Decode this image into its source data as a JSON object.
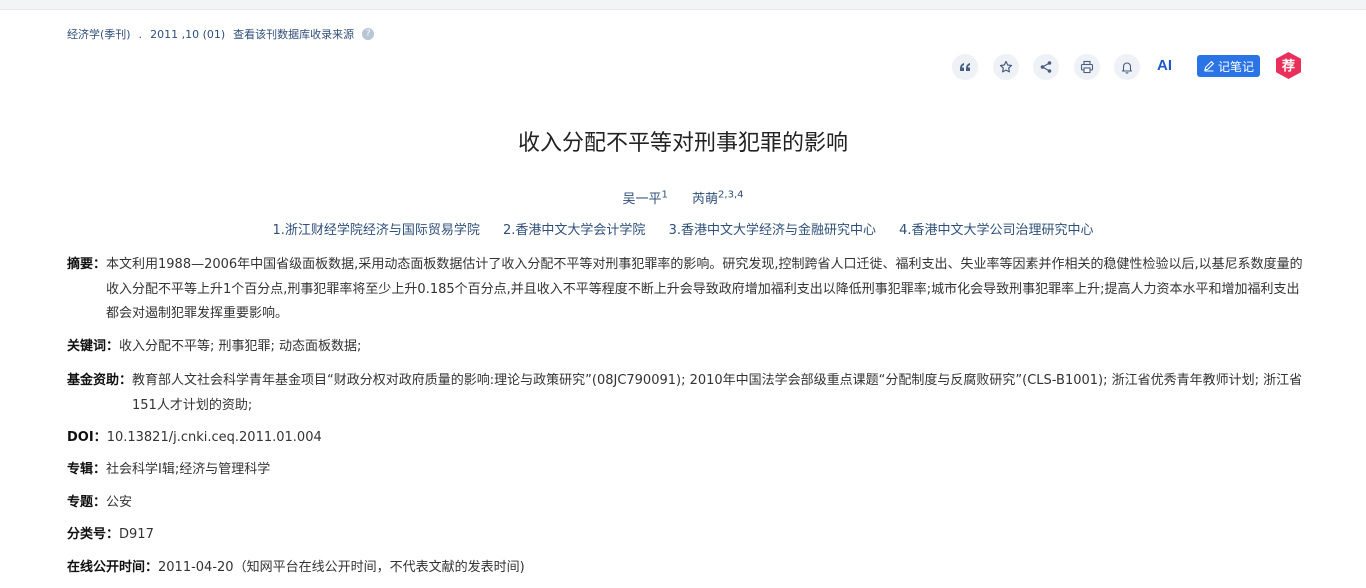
{
  "source": {
    "journal": "经济学(季刊)",
    "sep": ".",
    "issue": "2011 ,10 (01)",
    "link": "查看该刊数据库收录来源",
    "help": "?"
  },
  "toolbar": {
    "ai_label": "AI",
    "note_label": "记笔记",
    "rec_label": "荐"
  },
  "article": {
    "title": "收入分配不平等对刑事犯罪的影响",
    "authors": [
      {
        "name": "吴一平",
        "sup": "1"
      },
      {
        "name": "芮萌",
        "sup": "2,3,4"
      }
    ],
    "affiliations": [
      "1.浙江财经学院经济与国际贸易学院",
      "2.香港中文大学会计学院",
      "3.香港中文大学经济与金融研究中心",
      "4.香港中文大学公司治理研究中心"
    ]
  },
  "fields": {
    "abstract_label": "摘要：",
    "abstract": "本文利用1988—2006年中国省级面板数据,采用动态面板数据估计了收入分配不平等对刑事犯罪率的影响。研究发现,控制跨省人口迁徙、福利支出、失业率等因素并作相关的稳健性检验以后,以基尼系数度量的收入分配不平等上升1个百分点,刑事犯罪率将至少上升0.185个百分点,并且收入不平等程度不断上升会导致政府增加福利支出以降低刑事犯罪率;城市化会导致刑事犯罪率上升;提高人力资本水平和增加福利支出都会对遏制犯罪发挥重要影响。",
    "keywords_label": "关键词：",
    "keywords": "收入分配不平等;  刑事犯罪;  动态面板数据;",
    "fund_label": "基金资助：",
    "fund": "教育部人文社会科学青年基金项目“财政分权对政府质量的影响:理论与政策研究”(08JC790091);  2010年中国法学会部级重点课题“分配制度与反腐败研究”(CLS-B1001);  浙江省优秀青年教师计划;  浙江省151人才计划的资助;",
    "doi_label": "DOI：",
    "doi": "10.13821/j.cnki.ceq.2011.01.004",
    "series_label": "专辑：",
    "series": "社会科学Ⅰ辑;经济与管理科学",
    "topic_label": "专题：",
    "topic": "公安",
    "class_label": "分类号：",
    "class_no": "D917",
    "online_label": "在线公开时间：",
    "online": "2011-04-20（知网平台在线公开时间，不代表文献的发表时间)"
  },
  "colors": {
    "link": "#2f4f7a",
    "accent": "#2b74e6",
    "rec": "#e8305a"
  }
}
